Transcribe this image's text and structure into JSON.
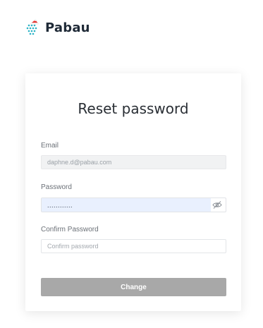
{
  "brand": {
    "name": "Pabau",
    "logo_icon": "pabau-santa-hat-logo-icon"
  },
  "form": {
    "title": "Reset password",
    "email": {
      "label": "Email",
      "value": "daphne.d@pabau.com"
    },
    "password": {
      "label": "Password",
      "value": "............",
      "toggle_icon": "eye-slash-icon"
    },
    "confirm": {
      "label": "Confirm Password",
      "placeholder": "Confirm password",
      "value": ""
    },
    "submit_label": "Change"
  },
  "colors": {
    "brand_teal": "#2bb3c6",
    "hat_red": "#e53935",
    "autofill_bg": "#e9f0fe",
    "button_disabled": "#a8a8a8"
  }
}
